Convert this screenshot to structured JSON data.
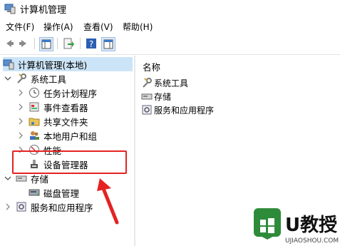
{
  "window": {
    "title": "计算机管理"
  },
  "menu": [
    {
      "label": "文件(F)"
    },
    {
      "label": "操作(A)"
    },
    {
      "label": "查看(V)"
    },
    {
      "label": "帮助(H)"
    }
  ],
  "tree": {
    "root": "计算机管理(本地)",
    "system_tools": "系统工具",
    "task_scheduler": "任务计划程序",
    "event_viewer": "事件查看器",
    "shared_folders": "共享文件夹",
    "local_users": "本地用户和组",
    "performance": "性能",
    "device_manager": "设备管理器",
    "storage": "存储",
    "disk_management": "磁盘管理",
    "services_apps": "服务和应用程序"
  },
  "list": {
    "header": "名称",
    "items": [
      {
        "label": "系统工具",
        "icon": "tools-icon"
      },
      {
        "label": "存储",
        "icon": "storage-icon"
      },
      {
        "label": "服务和应用程序",
        "icon": "services-icon"
      }
    ]
  },
  "watermark": {
    "brand": "U教授",
    "url": "UJIAOSHOU.COM"
  },
  "colors": {
    "highlight": "#e52222",
    "accent": "#1e6fc4",
    "watermark_green": "#2e8b3a"
  }
}
